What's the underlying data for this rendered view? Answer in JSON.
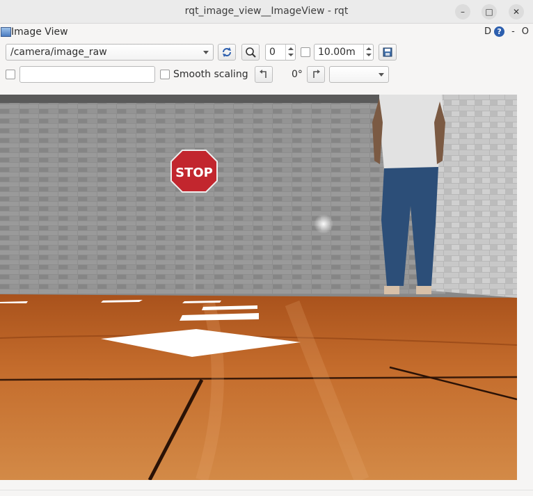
{
  "window": {
    "title": "rqt_image_view__ImageView - rqt",
    "minimize_glyph": "–",
    "maximize_glyph": "□",
    "close_glyph": "✕"
  },
  "panel": {
    "title": "Image View",
    "d_label": "D",
    "help_glyph": "?",
    "dash_label": "-",
    "o_label": "O"
  },
  "toolbar": {
    "topic": "/camera/image_raw",
    "zoom_value": "0",
    "timeout_value": "10.00m",
    "smooth_scaling_label": "Smooth scaling",
    "rotation_label": "0°",
    "topic_filter_value": ""
  },
  "image": {
    "stop_sign_text": "STOP"
  },
  "colors": {
    "accent": "#2d5fae",
    "wall": "#8f8f8f",
    "floor": "#c06a2a",
    "stop_sign": "#c2262e"
  },
  "icons": {
    "refresh": "refresh-icon",
    "zoom": "zoom-icon",
    "save": "save-icon",
    "rotate_left": "rotate-left-icon",
    "rotate_right": "rotate-right-icon"
  }
}
